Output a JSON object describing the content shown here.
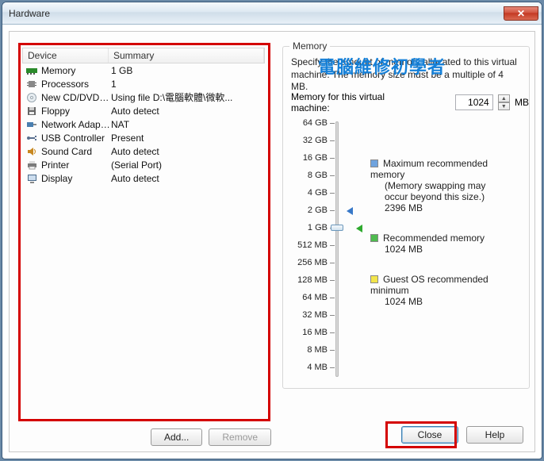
{
  "window": {
    "title": "Hardware",
    "close_glyph": "✕"
  },
  "watermark": "電腦維修初學者",
  "table": {
    "col_device": "Device",
    "col_summary": "Summary",
    "rows": [
      {
        "icon": "memory",
        "device": "Memory",
        "summary": "1 GB"
      },
      {
        "icon": "cpu",
        "device": "Processors",
        "summary": "1"
      },
      {
        "icon": "cd",
        "device": "New CD/DVD (...",
        "summary": "Using file D:\\電腦軟體\\微軟..."
      },
      {
        "icon": "floppy",
        "device": "Floppy",
        "summary": "Auto detect"
      },
      {
        "icon": "net",
        "device": "Network Adapter",
        "summary": "NAT"
      },
      {
        "icon": "usb",
        "device": "USB Controller",
        "summary": "Present"
      },
      {
        "icon": "sound",
        "device": "Sound Card",
        "summary": "Auto detect"
      },
      {
        "icon": "printer",
        "device": "Printer",
        "summary": "(Serial Port)"
      },
      {
        "icon": "display",
        "device": "Display",
        "summary": "Auto detect"
      }
    ]
  },
  "buttons": {
    "add": "Add...",
    "remove": "Remove",
    "close": "Close",
    "help": "Help"
  },
  "memory": {
    "group_title": "Memory",
    "desc_l1": "Specify the amount of memory allocated to this virtual",
    "desc_l2": "machine. The memory size must be a multiple of 4 MB.",
    "label": "Memory for this virtual machine:",
    "value": "1024",
    "unit": "MB",
    "ticks": [
      "64 GB",
      "32 GB",
      "16 GB",
      "8 GB",
      "4 GB",
      "2 GB",
      "1 GB",
      "512 MB",
      "256 MB",
      "128 MB",
      "64 MB",
      "32 MB",
      "16 MB",
      "8 MB",
      "4 MB"
    ],
    "slider_index": 6,
    "blue_at": 5,
    "green_at": 6,
    "legend": {
      "max_t": "Maximum recommended memory",
      "max_s1": "(Memory swapping may",
      "max_s2": "occur beyond this size.)",
      "max_v": "2396 MB",
      "rec_t": "Recommended memory",
      "rec_v": "1024 MB",
      "min_t": "Guest OS recommended minimum",
      "min_v": "1024 MB"
    }
  },
  "icon_colors": {
    "memory": "#2a8a2a",
    "cpu": "#888",
    "cd": "#9aa7b0",
    "floppy": "#666",
    "net": "#4a7fb0",
    "usb": "#5a7090",
    "sound": "#c88820",
    "printer": "#7a7a7a",
    "display": "#4a6a8a"
  }
}
